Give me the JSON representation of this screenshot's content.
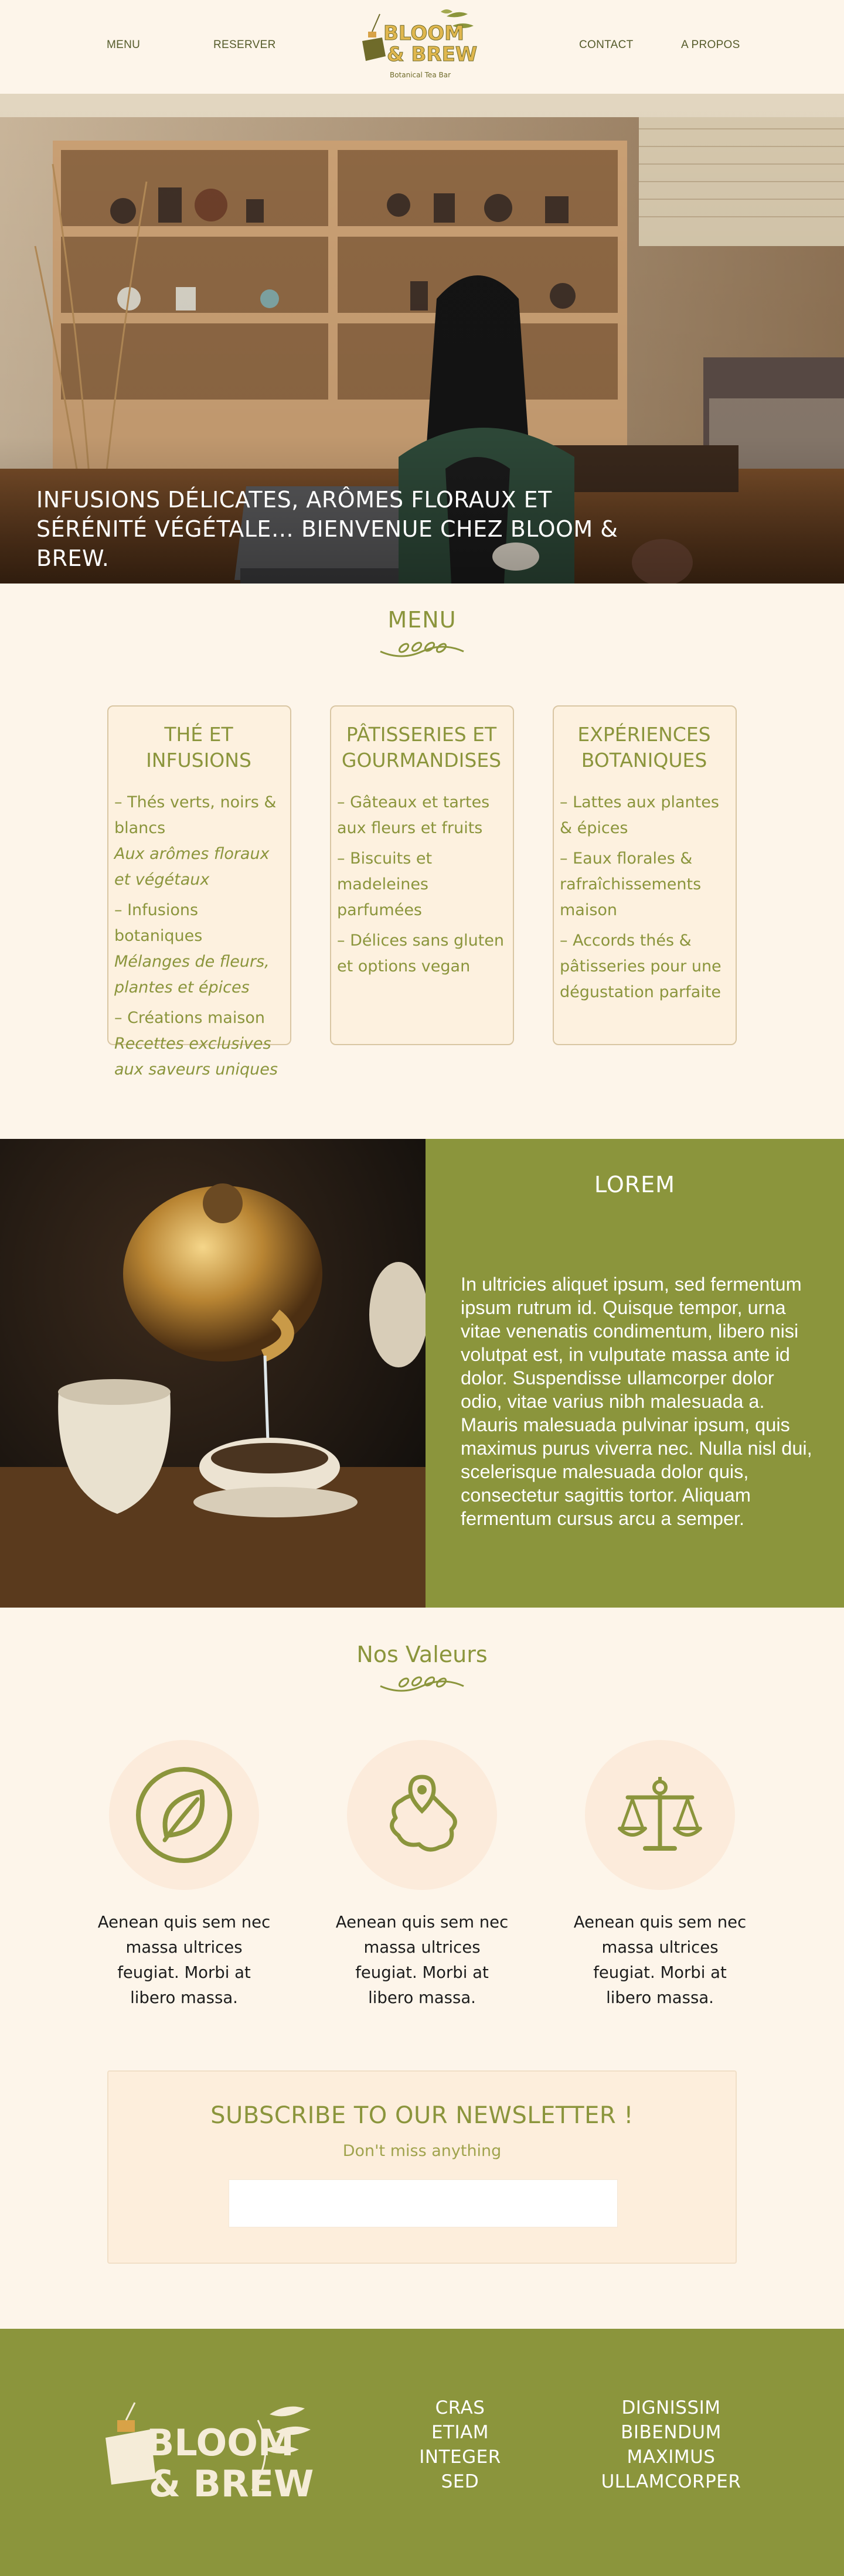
{
  "header": {
    "nav_left": [
      "MENU",
      "RESERVER"
    ],
    "nav_right": [
      "CONTACT",
      "A PROPOS"
    ],
    "logo": {
      "line1": "BLOOM",
      "line2": "& BREW",
      "tagline": "Botanical Tea Bar"
    }
  },
  "hero": {
    "caption": "INFUSIONS DÉLICATES, ARÔMES FLORAUX ET SÉRÉNITÉ VÉGÉTALE… BIENVENUE CHEZ BLOOM & BREW."
  },
  "menu": {
    "title": "MENU",
    "cards": [
      {
        "title": "THÉ ET INFUSIONS",
        "items": [
          {
            "main": "– Thés verts, noirs & blancs",
            "sub": "Aux arômes floraux et végétaux"
          },
          {
            "main": "– Infusions botaniques",
            "sub": "Mélanges de fleurs, plantes et épices"
          },
          {
            "main": "– Créations maison",
            "sub": "Recettes exclusives aux saveurs uniques"
          }
        ]
      },
      {
        "title": "PÂTISSERIES ET GOURMANDISES",
        "items": [
          {
            "main": "– Gâteaux et tartes aux fleurs et fruits",
            "sub": ""
          },
          {
            "main": "– Biscuits et madeleines parfumées",
            "sub": ""
          },
          {
            "main": "– Délices sans gluten et options vegan",
            "sub": ""
          }
        ]
      },
      {
        "title": "EXPÉRIENCES BOTANIQUES",
        "items": [
          {
            "main": "– Lattes aux plantes & épices",
            "sub": ""
          },
          {
            "main": "– Eaux florales & rafraîchissements maison",
            "sub": ""
          },
          {
            "main": "– Accords thés & pâtisseries pour une dégustation parfaite",
            "sub": ""
          }
        ]
      }
    ]
  },
  "lorem": {
    "title": "LOREM",
    "text": "In ultricies aliquet ipsum, sed fermentum ipsum rutrum id. Quisque tempor, urna vitae venenatis condimentum, libero nisi volutpat est, in  vulputate massa ante id dolor. Suspendisse ullamcorper dolor odio, vitae varius nibh malesuada a. Mauris malesuada pulvinar ipsum, quis maximus  purus viverra nec. Nulla nisl dui, scelerisque malesuada dolor quis,  consectetur sagittis tortor. Aliquam fermentum cursus arcu a semper."
  },
  "values": {
    "title": "Nos Valeurs",
    "items": [
      {
        "icon": "leaf-icon",
        "text": "Aenean quis sem nec massa ultrices feugiat. Morbi at libero massa."
      },
      {
        "icon": "map-pin-icon",
        "text": "Aenean quis sem nec massa ultrices feugiat. Morbi at libero massa."
      },
      {
        "icon": "scales-icon",
        "text": "Aenean quis sem nec massa ultrices feugiat. Morbi at libero massa."
      }
    ]
  },
  "newsletter": {
    "title": "SUBSCRIBE TO OUR NEWSLETTER !",
    "subtitle": "Don't miss anything",
    "input_value": ""
  },
  "footer": {
    "logo": {
      "line1": "BLOOM",
      "line2": "& BREW"
    },
    "col1": [
      "CRAS",
      "ETIAM",
      "INTEGER",
      "SED"
    ],
    "col2": [
      "DIGNISSIM",
      "BIBENDUM",
      "MAXIMUS",
      "ULLAMCORPER"
    ]
  },
  "colors": {
    "accent": "#8b953c",
    "background": "#fdf5ea",
    "card_background": "#fdf1df",
    "value_circle": "#fcebdb"
  }
}
